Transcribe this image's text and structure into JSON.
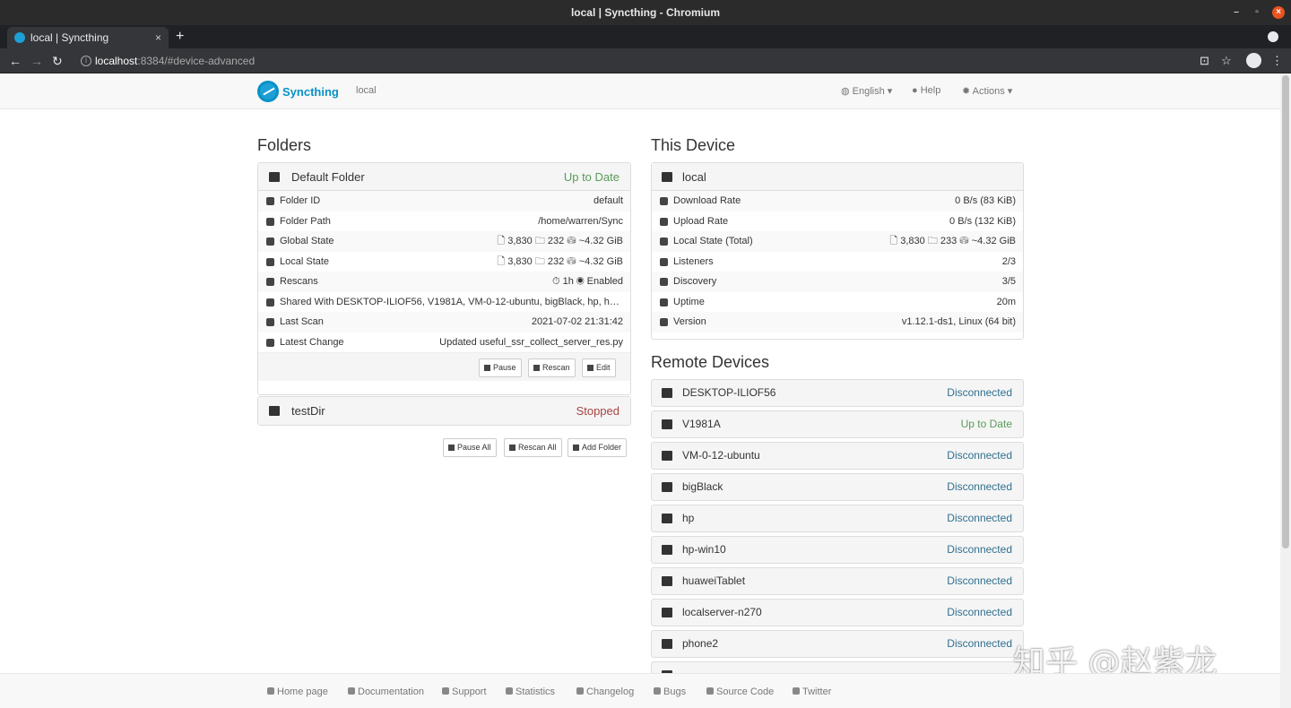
{
  "window": {
    "title": "local | Syncthing - Chromium"
  },
  "tab": {
    "title": "local | Syncthing",
    "close": "×",
    "new": "+"
  },
  "address": {
    "host": "localhost",
    "rest": ":8384/#device-advanced"
  },
  "navbar": {
    "brand": "Syncthing",
    "device": "local",
    "language": "English ▾",
    "help": "Help",
    "actions": "Actions ▾"
  },
  "folders": {
    "heading": "Folders",
    "items": [
      {
        "name": "Default Folder",
        "status": "Up to Date"
      },
      {
        "name": "testDir",
        "status": "Stopped"
      }
    ],
    "details": [
      {
        "label": "Folder ID",
        "value": "default"
      },
      {
        "label": "Folder Path",
        "value": "/home/warren/Sync"
      },
      {
        "label": "Global State",
        "value": "🗋 3,830  🗀 232  ⛁ ~4.32 GiB"
      },
      {
        "label": "Local State",
        "value": "🗋 3,830  🗀 232  ⛁ ~4.32 GiB"
      },
      {
        "label": "Rescans",
        "value": "⏱ 1h  ◉ Enabled"
      },
      {
        "label": "Shared With",
        "value": "DESKTOP-ILIOF56, V1981A, VM-0-12-ubuntu, bigBlack, hp, hp..."
      },
      {
        "label": "Last Scan",
        "value": "2021-07-02 21:31:42"
      },
      {
        "label": "Latest Change",
        "value": "Updated useful_ssr_collect_server_res.py"
      }
    ],
    "buttons": {
      "pause": "Pause",
      "rescan": "Rescan",
      "edit": "Edit"
    },
    "global_buttons": {
      "pause_all": "Pause All",
      "rescan_all": "Rescan All",
      "add_folder": "Add Folder"
    }
  },
  "this_device": {
    "heading": "This Device",
    "name": "local",
    "rows": [
      {
        "label": "Download Rate",
        "value": "0 B/s (83 KiB)"
      },
      {
        "label": "Upload Rate",
        "value": "0 B/s (132 KiB)"
      },
      {
        "label": "Local State (Total)",
        "value": "🗋 3,830  🗀 233  ⛁ ~4.32 GiB"
      },
      {
        "label": "Listeners",
        "value": "2/3"
      },
      {
        "label": "Discovery",
        "value": "3/5"
      },
      {
        "label": "Uptime",
        "value": "20m"
      },
      {
        "label": "Version",
        "value": "v1.12.1-ds1, Linux (64 bit)"
      }
    ]
  },
  "remote_devices": {
    "heading": "Remote Devices",
    "items": [
      {
        "name": "DESKTOP-ILIOF56",
        "status": "Disconnected"
      },
      {
        "name": "V1981A",
        "status": "Up to Date"
      },
      {
        "name": "VM-0-12-ubuntu",
        "status": "Disconnected"
      },
      {
        "name": "bigBlack",
        "status": "Disconnected"
      },
      {
        "name": "hp",
        "status": "Disconnected"
      },
      {
        "name": "hp-win10",
        "status": "Disconnected"
      },
      {
        "name": "huaweiTablet",
        "status": "Disconnected"
      },
      {
        "name": "localserver-n270",
        "status": "Disconnected"
      },
      {
        "name": "phone2",
        "status": "Disconnected"
      }
    ]
  },
  "footer": {
    "links": [
      "Home page",
      "Documentation",
      "Support",
      "Statistics",
      "Changelog",
      "Bugs",
      "Source Code",
      "Twitter"
    ]
  },
  "watermark": "知乎 @赵紫龙",
  "colors": {
    "brand": "#0891c7",
    "up_to_date": "#5a9a5a",
    "stopped": "#a94442",
    "disconnected": "#31708f"
  }
}
